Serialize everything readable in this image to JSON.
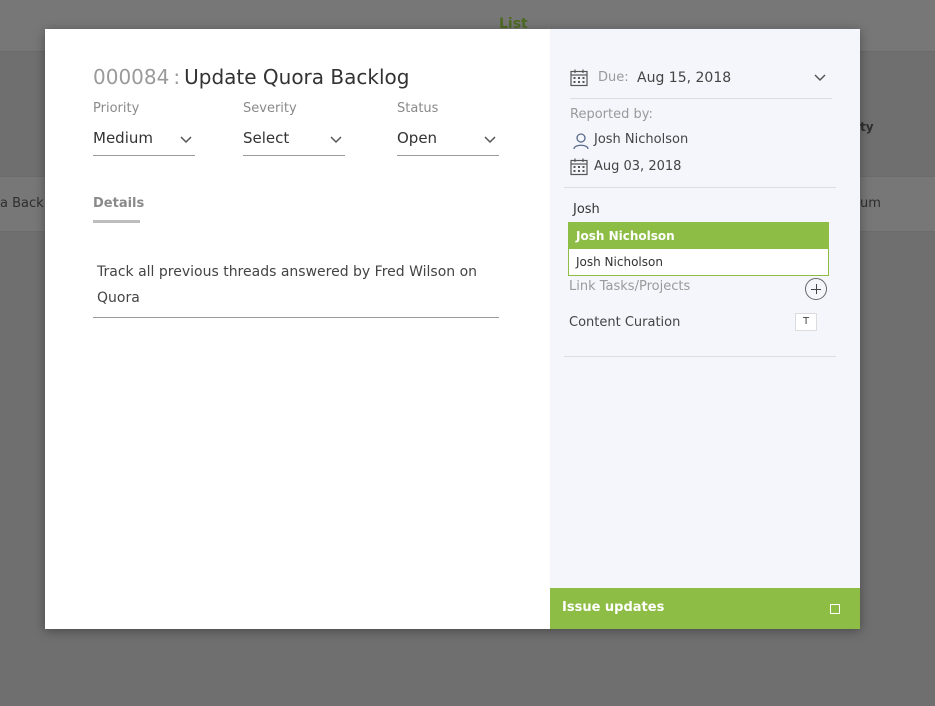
{
  "background": {
    "list_title": "List",
    "row_text_left": "a Back",
    "col_header_right": "ty",
    "row_text_right": "um"
  },
  "issue": {
    "id": "000084",
    "separator": ":",
    "title": "Update Quora Backlog"
  },
  "fields": {
    "priority": {
      "label": "Priority",
      "value": "Medium"
    },
    "severity": {
      "label": "Severity",
      "value": "Select"
    },
    "status": {
      "label": "Status",
      "value": "Open"
    }
  },
  "tabs": {
    "details": "Details"
  },
  "description": "Track all previous threads answered by Fred Wilson on Quora",
  "side": {
    "due_label": "Due:",
    "due_value": "Aug 15, 2018",
    "reported_label": "Reported by:",
    "reporter_name": "Josh Nicholson",
    "reported_date": "Aug 03, 2018",
    "assignee_input": "Josh",
    "suggestions": [
      "Josh Nicholson",
      "Josh Nicholson"
    ],
    "link_label": "Link Tasks/Projects",
    "linked_item": "Content Curation",
    "linked_item_tag": "T",
    "updates_label": "Issue updates"
  },
  "colors": {
    "accent": "#8dbd45",
    "overlay": "#6f6f6f",
    "side_bg": "#f4f6fc"
  }
}
